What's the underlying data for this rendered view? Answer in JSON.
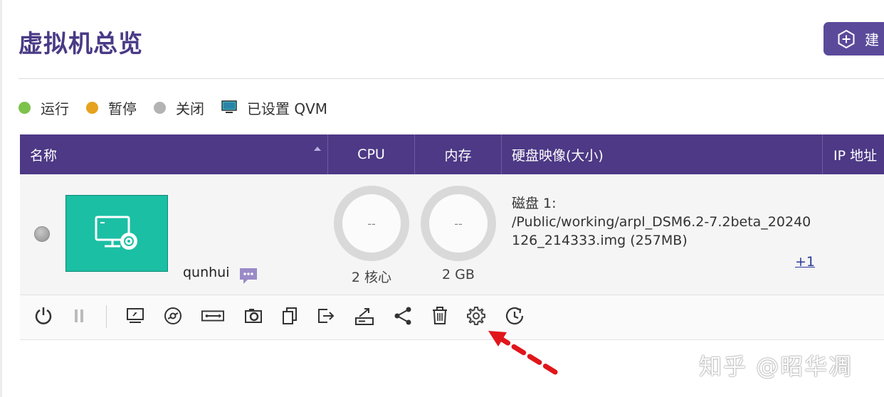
{
  "page": {
    "title": "虚拟机总览",
    "create_button_label": "建"
  },
  "legend": [
    {
      "label": "运行",
      "color": "#7dc24b"
    },
    {
      "label": "暂停",
      "color": "#e6a21d"
    },
    {
      "label": "关闭",
      "color": "#b3b3b3"
    },
    {
      "label": "已设置 QVM",
      "icon": "monitor-icon"
    }
  ],
  "table": {
    "headers": {
      "name": "名称",
      "cpu": "CPU",
      "memory": "内存",
      "disk": "硬盘映像(大小)",
      "ip": "IP 地址"
    },
    "rows": [
      {
        "status": "关闭",
        "name": "qunhui",
        "cpu_value": "--",
        "cpu_label": "2 核心",
        "mem_value": "--",
        "mem_label": "2 GB",
        "disk_text": "磁盘 1:\n/Public/working/arpl_DSM6.2-7.2beta_20240126_214333.img (257MB)",
        "disk_title": "磁盘 1:",
        "disk_path": "/Public/working/arpl_DSM6.2-7.2beta_20240126_214333.img (257MB)",
        "more_disks": "+1"
      }
    ]
  },
  "toolbar": [
    "power-icon",
    "pause-icon",
    "console-icon",
    "disc-icon",
    "usb-icon",
    "snapshot-icon",
    "clone-icon",
    "export-icon",
    "migrate-icon",
    "share-icon",
    "delete-icon",
    "settings-icon",
    "schedule-icon"
  ],
  "colors": {
    "header": "#4d3985",
    "title": "#4a3a86",
    "accent": "#5b4a9a",
    "annotation": "#e0161b"
  },
  "watermark": "知乎 @昭华凋"
}
